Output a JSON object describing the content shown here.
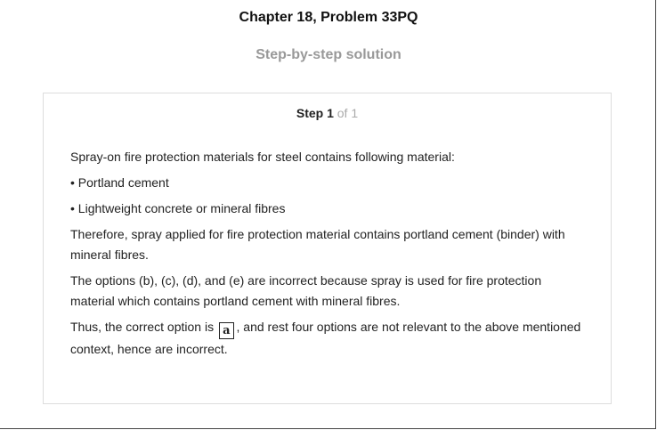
{
  "header": {
    "title": "Chapter 18, Problem 33PQ",
    "subtitle": "Step-by-step solution"
  },
  "step": {
    "label": "Step 1",
    "of": "of 1",
    "intro": "Spray-on fire protection materials for steel contains following material:",
    "bullets": [
      "• Portland cement",
      "• Lightweight concrete or mineral fibres"
    ],
    "para1": "Therefore, spray applied for fire protection material contains portland cement (binder) with mineral fibres.",
    "para2": "The options (b), (c), (d), and (e) are incorrect because spray is used for fire protection material which contains portland cement with mineral fibres.",
    "para3_before": "Thus, the correct option is",
    "answer": "a",
    "para3_after": ", and rest four options are not relevant to the above mentioned context, hence are incorrect."
  }
}
